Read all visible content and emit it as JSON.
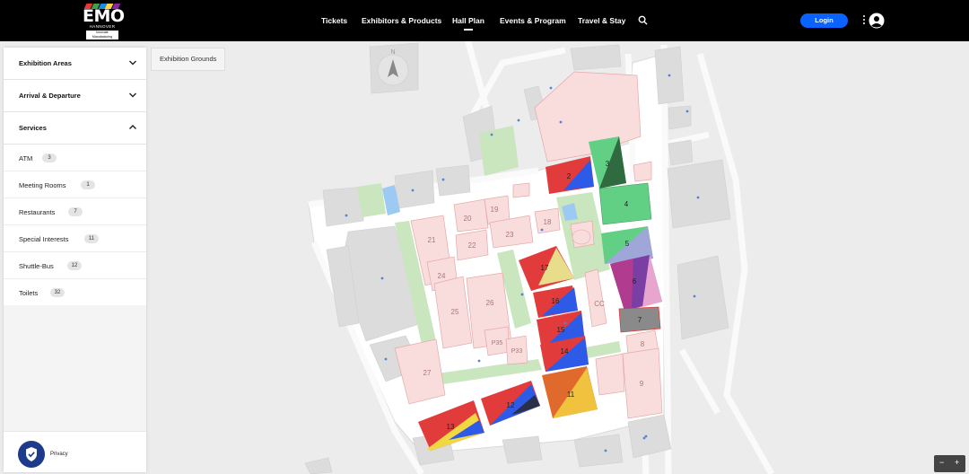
{
  "brand": {
    "logo_text": "EMO",
    "logo_sub": "HANNOVER",
    "logo_tag": "Innovate Manufacturing"
  },
  "nav": {
    "items": [
      "Tickets",
      "Exhibitors & Products",
      "Hall Plan",
      "Events & Program",
      "Travel & Stay"
    ],
    "active": "Hall Plan",
    "login_label": "Login"
  },
  "sidebar": {
    "sections": [
      {
        "label": "Exhibition Areas",
        "expanded": false
      },
      {
        "label": "Arrival & Departure",
        "expanded": false
      },
      {
        "label": "Services",
        "expanded": true
      }
    ],
    "services": [
      {
        "label": "ATM",
        "count": "3"
      },
      {
        "label": "Meeting Rooms",
        "count": "1"
      },
      {
        "label": "Restaurants",
        "count": "7"
      },
      {
        "label": "Special Interests",
        "count": "11"
      },
      {
        "label": "Shuttle-Bus",
        "count": "12"
      },
      {
        "label": "Toilets",
        "count": "32"
      }
    ],
    "privacy_label": "Privacy"
  },
  "breadcrumb": "Exhibition Grounds",
  "map": {
    "compass_label": "N",
    "halls": [
      "2",
      "3",
      "4",
      "5",
      "6",
      "7",
      "8",
      "9",
      "11",
      "12",
      "13",
      "14",
      "15",
      "16",
      "17",
      "18",
      "19",
      "20",
      "21",
      "22",
      "23",
      "24",
      "25",
      "26",
      "27"
    ],
    "other_labels": [
      "CC",
      "P35",
      "P33"
    ]
  },
  "zoom": {
    "out": "−",
    "in": "+"
  },
  "colors": {
    "accent_blue": "#0a63ff",
    "hall_pink": "#f9dcdc",
    "green_area": "#c9e6bf",
    "road": "#ffffff",
    "background": "#ececec"
  }
}
